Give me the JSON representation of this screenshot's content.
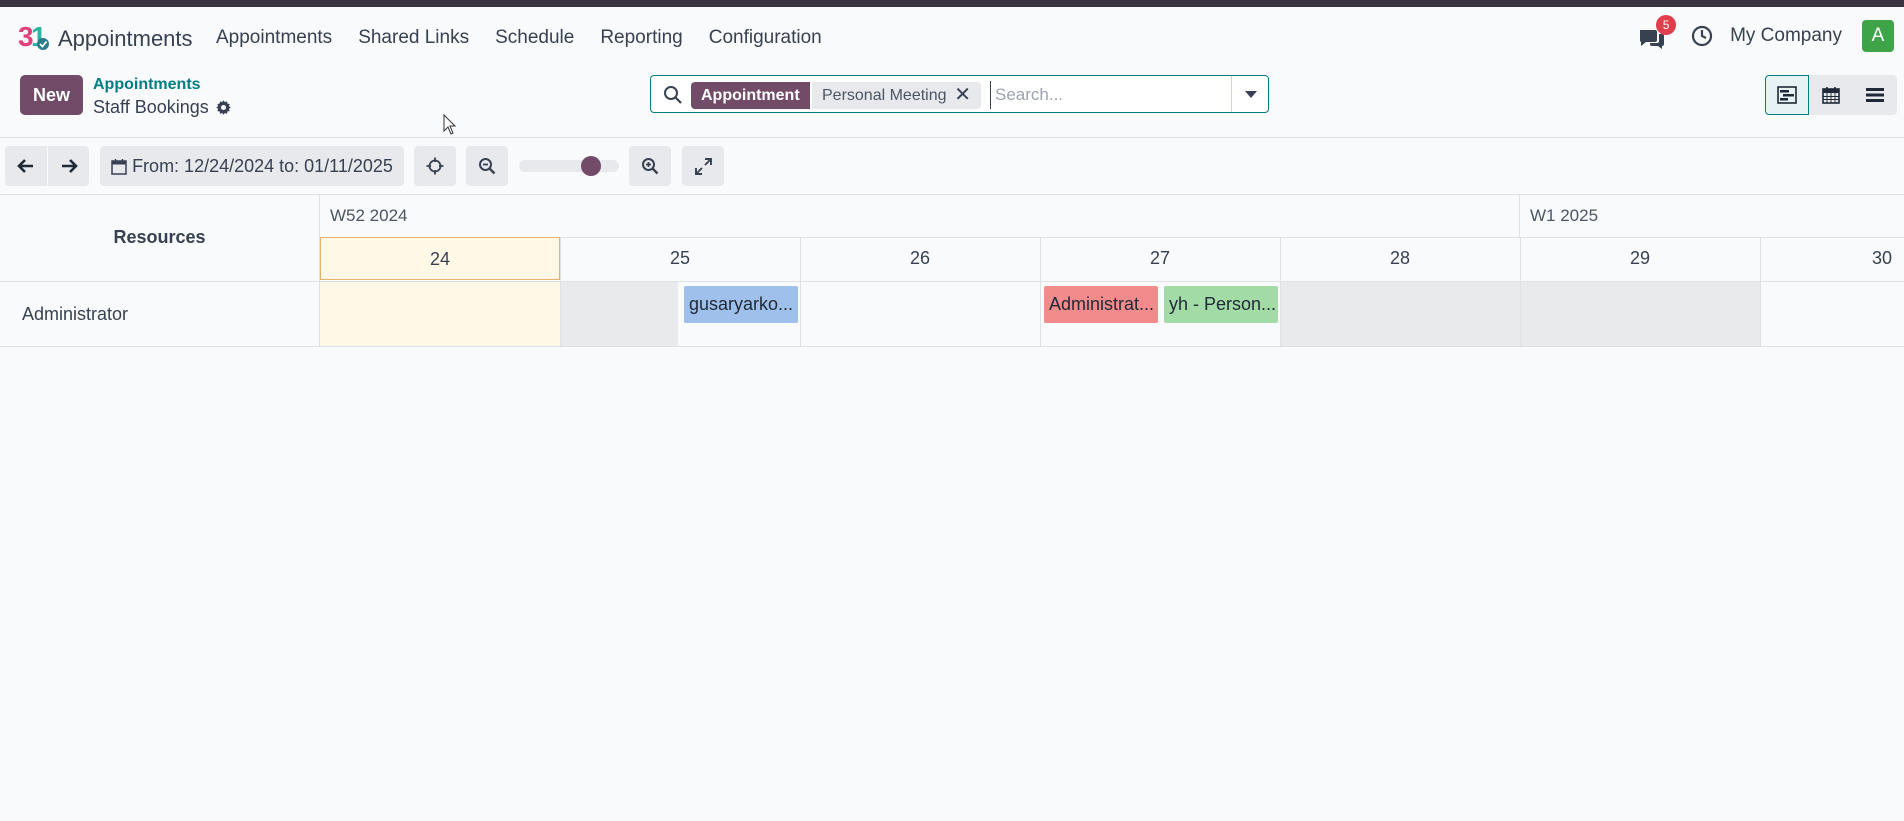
{
  "app": {
    "name": "Appointments"
  },
  "menu": [
    "Appointments",
    "Shared Links",
    "Schedule",
    "Reporting",
    "Configuration"
  ],
  "systray": {
    "chat_count": "5",
    "company": "My Company",
    "avatar_letter": "A"
  },
  "control": {
    "new_label": "New",
    "breadcrumb_parent": "Appointments",
    "breadcrumb_current": "Staff Bookings"
  },
  "search": {
    "facet_type": "Appointment",
    "facet_value": "Personal Meeting",
    "placeholder": "Search..."
  },
  "toolbar": {
    "range_label": "From: 12/24/2024 to: 01/11/2025",
    "zoom_level": 0.7
  },
  "gantt": {
    "resources_header": "Resources",
    "weeks": [
      "W52 2024",
      "W1 2025"
    ],
    "days": [
      "24",
      "25",
      "26",
      "27",
      "28",
      "29",
      "30"
    ],
    "rows": [
      {
        "name": "Administrator",
        "events": [
          {
            "label": "gusaryarko...",
            "color": "#9ec0ea"
          },
          {
            "label": "Administrat...",
            "color": "#f28b8b"
          },
          {
            "label": "yh - Person...",
            "color": "#a3dba7"
          }
        ]
      }
    ]
  },
  "colors": {
    "brand": "#714b67",
    "accent": "#017e84",
    "today_bg": "#fef9e7",
    "weekend_bg": "#e9eaec"
  }
}
